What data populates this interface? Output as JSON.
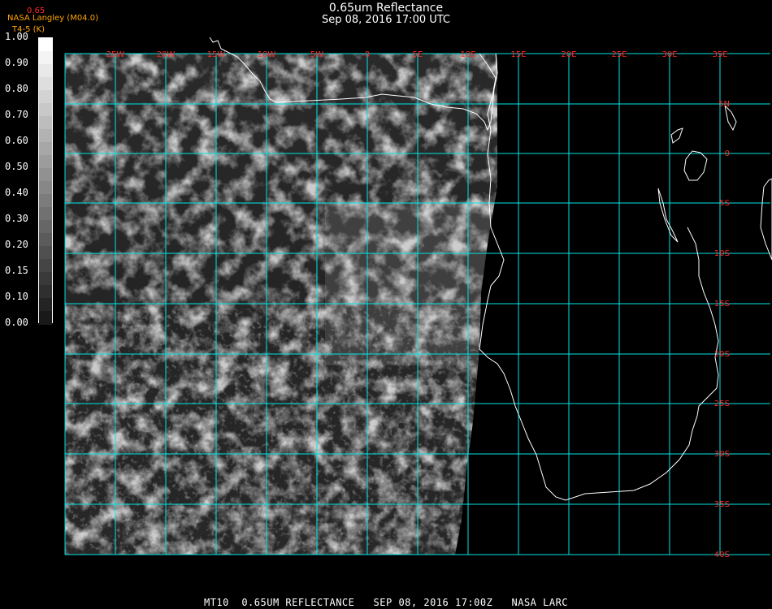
{
  "header": {
    "title": "0.65um Reflectance",
    "datetime": "Sep 08, 2016 17:00 UTC",
    "credit_line1": "NASA Langley (M04.0)",
    "credit_line2": "T4-5 (K)",
    "variable_label": "0.65"
  },
  "colorbar": {
    "labels": [
      "1.00",
      "0.90",
      "0.80",
      "0.70",
      "0.60",
      "0.50",
      "0.40",
      "0.30",
      "0.20",
      "0.15",
      "0.10",
      "0.00"
    ]
  },
  "map": {
    "lon_labels": [
      "25W",
      "20W",
      "15W",
      "10W",
      "5W",
      "0",
      "5E",
      "10E",
      "15E",
      "20E",
      "25E",
      "30E",
      "35E"
    ],
    "lat_labels": [
      "5N",
      "0",
      "5S",
      "10S",
      "15S",
      "20S",
      "25S",
      "30S",
      "35S",
      "40S"
    ],
    "grid_color": "#00e5e5",
    "label_color": "#ff2a2a",
    "coast_color": "#ffffff"
  },
  "footer": {
    "text": "MT10  0.65UM REFLECTANCE   SEP 08, 2016 17:00Z   NASA LARC"
  }
}
